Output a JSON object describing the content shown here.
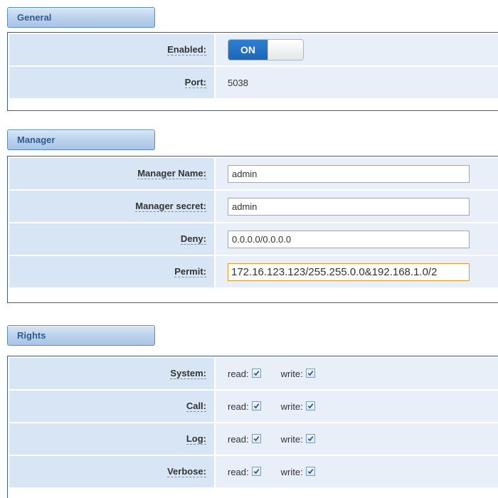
{
  "general": {
    "title": "General",
    "enabled_label": "Enabled:",
    "enabled_state": "ON",
    "port_label": "Port:",
    "port_value": "5038"
  },
  "manager": {
    "title": "Manager",
    "name_label": "Manager Name:",
    "name_value": "admin",
    "secret_label": "Manager secret:",
    "secret_value": "admin",
    "deny_label": "Deny:",
    "deny_value": "0.0.0.0/0.0.0.0",
    "permit_label": "Permit:",
    "permit_value": "172.16.123.123/255.255.0.0&192.168.1.0/2"
  },
  "rights": {
    "title": "Rights",
    "read_label": "read:",
    "write_label": "write:",
    "items": [
      {
        "label": "System:",
        "read": true,
        "write": true
      },
      {
        "label": "Call:",
        "read": true,
        "write": true
      },
      {
        "label": "Log:",
        "read": true,
        "write": true
      },
      {
        "label": "Verbose:",
        "read": true,
        "write": true
      }
    ]
  },
  "colors": {
    "section_tab_text": "#2e5d93",
    "label_bg": "#d7e5f4",
    "value_bg": "#e8eff8",
    "toggle_on": "#1f66b7",
    "focused_border": "#e59b2b"
  }
}
